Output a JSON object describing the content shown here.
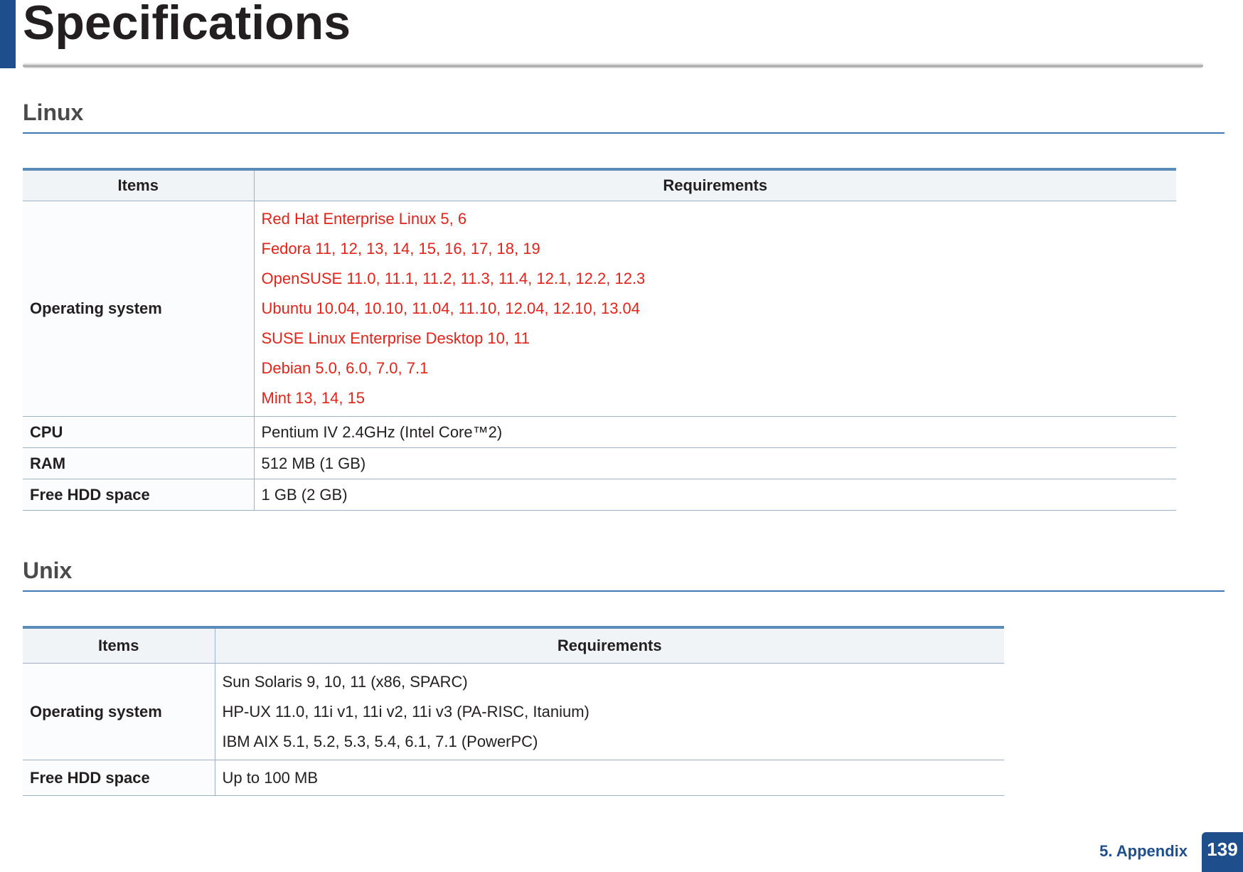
{
  "page": {
    "title": "Specifications",
    "footer_section": "5. Appendix",
    "page_number": "139"
  },
  "linux": {
    "heading": "Linux",
    "col_items": "Items",
    "col_requirements": "Requirements",
    "rows": {
      "os": {
        "label": "Operating system",
        "values": [
          "Red Hat Enterprise Linux 5, 6",
          "Fedora 11, 12, 13, 14, 15, 16, 17, 18, 19",
          "OpenSUSE 11.0, 11.1, 11.2, 11.3, 11.4, 12.1, 12.2, 12.3",
          "Ubuntu 10.04, 10.10, 11.04, 11.10, 12.04, 12.10, 13.04",
          "SUSE Linux Enterprise Desktop 10, 11",
          "Debian 5.0, 6.0, 7.0, 7.1",
          "Mint 13, 14, 15"
        ],
        "value_color": "#e2231a"
      },
      "cpu": {
        "label": "CPU",
        "value": "Pentium IV 2.4GHz (Intel Core™2)"
      },
      "ram": {
        "label": "RAM",
        "value": "512 MB (1 GB)"
      },
      "hdd": {
        "label": "Free HDD space",
        "value": "1 GB (2 GB)"
      }
    }
  },
  "unix": {
    "heading": "Unix",
    "col_items": "Items",
    "col_requirements": "Requirements",
    "rows": {
      "os": {
        "label": "Operating system",
        "values": [
          "Sun Solaris 9, 10, 11 (x86, SPARC)",
          "HP-UX 11.0, 11i v1, 11i v2, 11i v3 (PA-RISC, Itanium)",
          "IBM AIX 5.1, 5.2, 5.3, 5.4, 6.1, 7.1 (PowerPC)"
        ]
      },
      "hdd": {
        "label": "Free HDD space",
        "value": "Up to 100 MB"
      }
    }
  },
  "colors": {
    "accent": "#1f4e8c",
    "table_rule": "#5b8bb8",
    "highlight_text": "#e2231a"
  }
}
